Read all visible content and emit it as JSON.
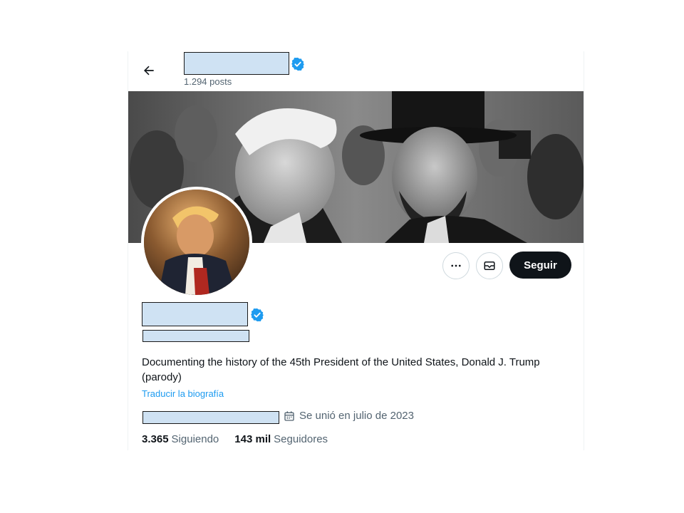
{
  "header": {
    "posts_count": "1.294 posts",
    "name_redacted": true
  },
  "profile": {
    "bio": "Documenting the history of the 45th President of the United States, Donald J. Trump (parody)",
    "translate_label": "Traducir la biografía",
    "joined": "Se unió en julio de 2023",
    "following_count": "3.365",
    "following_label": "Siguiendo",
    "followers_count": "143 mil",
    "followers_label": "Seguidores"
  },
  "actions": {
    "more_icon": "more-icon",
    "message_icon": "mail-icon",
    "follow_label": "Seguir"
  },
  "colors": {
    "accent": "#1d9bf0",
    "verified": "#1d9bf0",
    "follow_bg": "#0f1419",
    "secondary_text": "#536471",
    "redaction": "#cfe2f3"
  }
}
